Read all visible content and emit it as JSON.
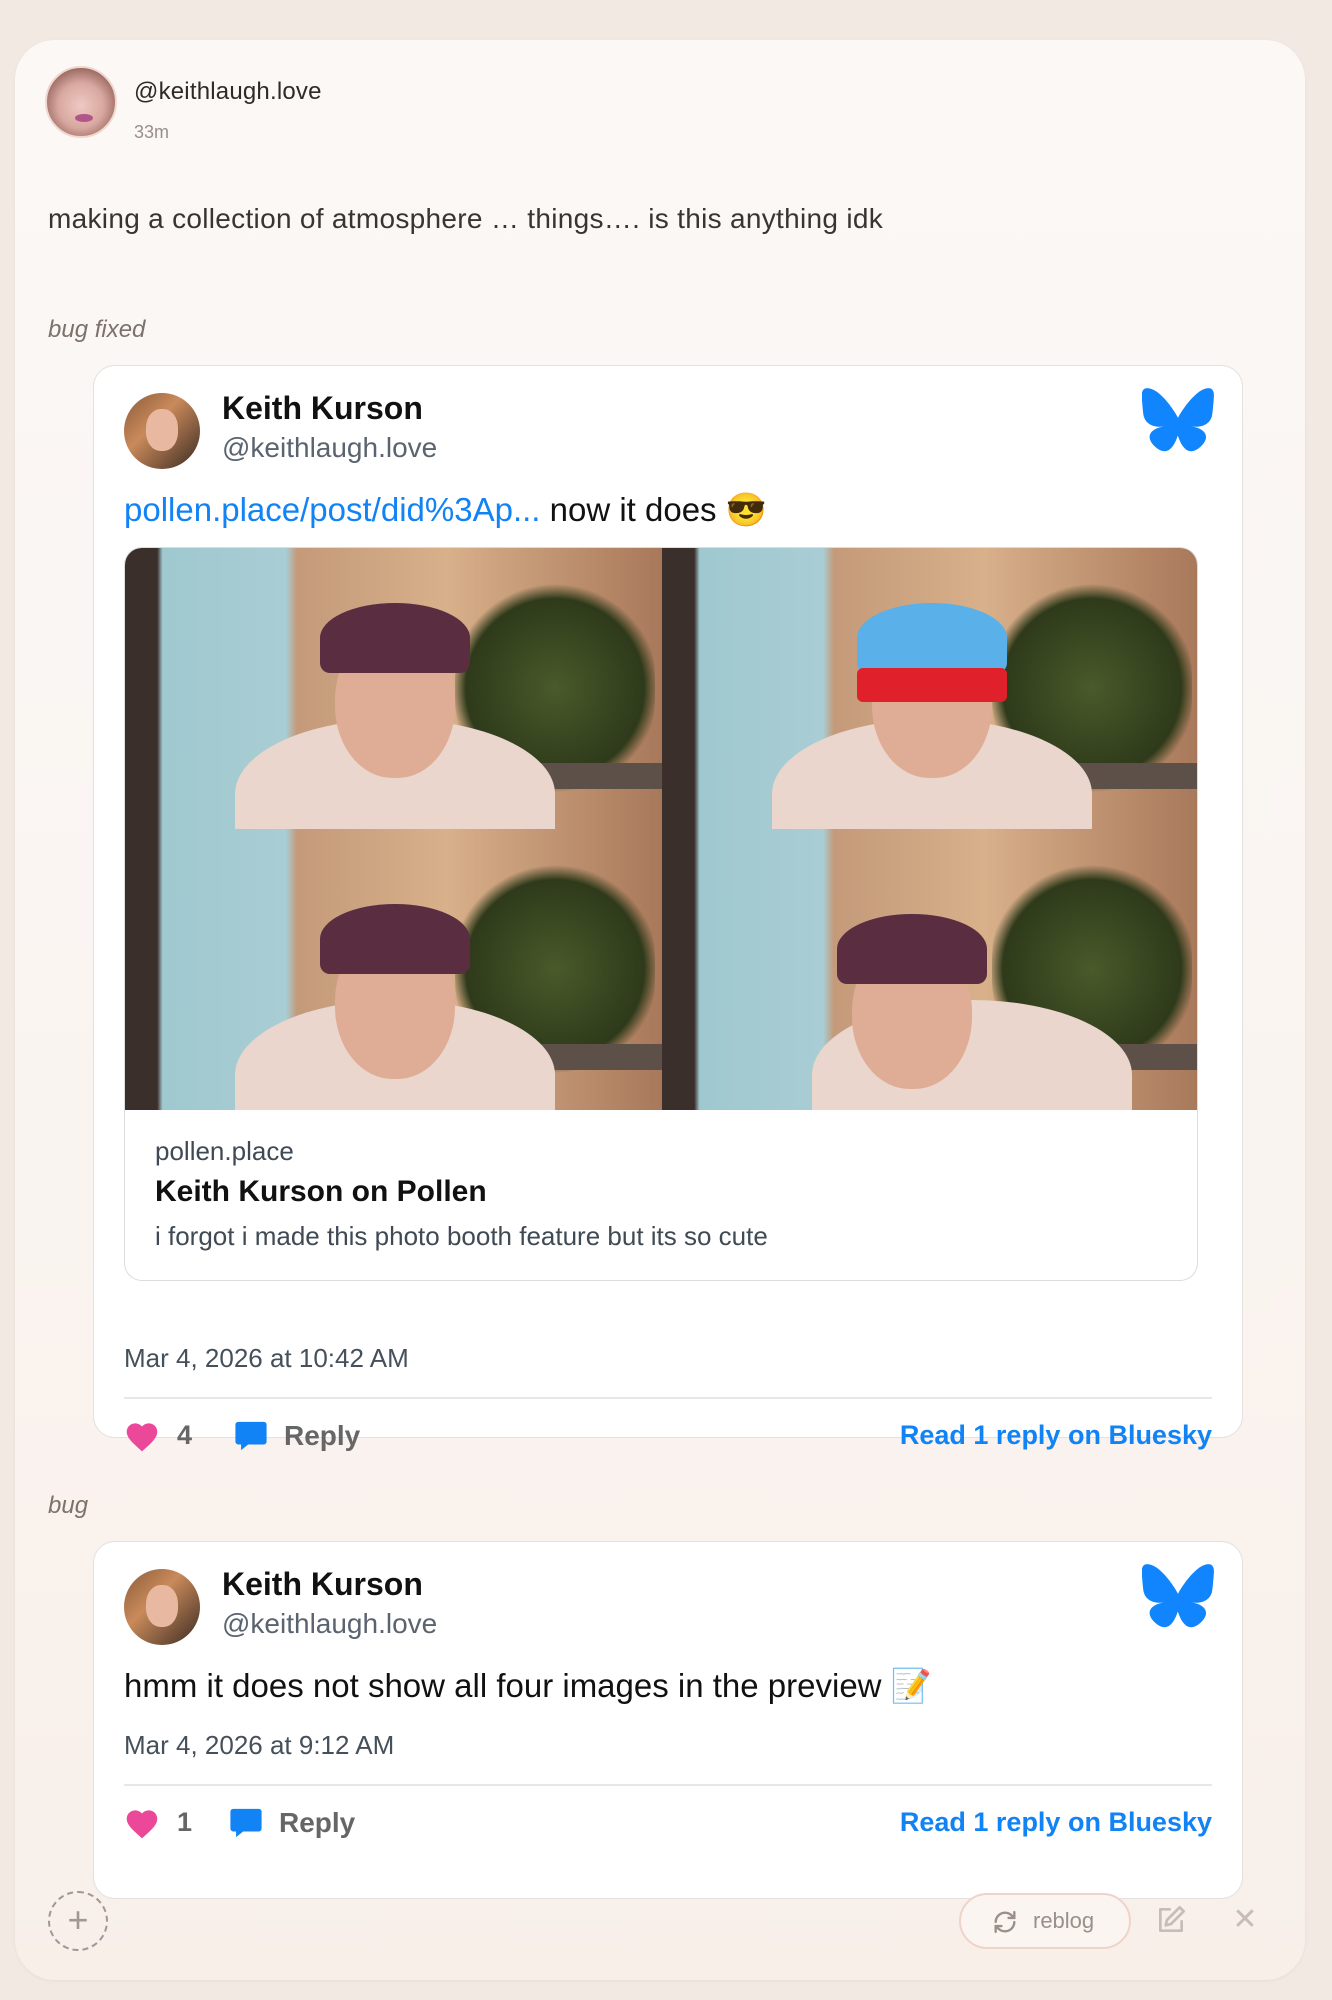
{
  "post": {
    "handle": "@keithlaugh.love",
    "time": "33m",
    "text": "making a collection of atmosphere … things…. is this anything idk"
  },
  "sections": [
    {
      "label": "bug fixed",
      "embed": {
        "name": "Keith Kurson",
        "handle": "@keithlaugh.love",
        "link_text": "pollen.place/post/did%3Ap...",
        "text": " now it does 😎",
        "link_card": {
          "domain": "pollen.place",
          "title": "Keith Kurson on Pollen",
          "description": "i forgot i made this photo booth feature but its so cute"
        },
        "date": "Mar 4, 2026 at 10:42 AM",
        "likes": "4",
        "reply_label": "Reply",
        "read_replies": "Read 1 reply on Bluesky"
      }
    },
    {
      "label": "bug",
      "embed": {
        "name": "Keith Kurson",
        "handle": "@keithlaugh.love",
        "text": "hmm it does not show all four images in the preview 📝",
        "date": "Mar 4, 2026 at 9:12 AM",
        "likes": "1",
        "reply_label": "Reply",
        "read_replies": "Read 1 reply on Bluesky"
      }
    }
  ],
  "footer": {
    "add_icon": "+",
    "reblog_label": "reblog",
    "close_icon": "✕"
  },
  "colors": {
    "link": "#1183f5",
    "heart": "#ec4899",
    "bluesky": "#1185fe"
  }
}
